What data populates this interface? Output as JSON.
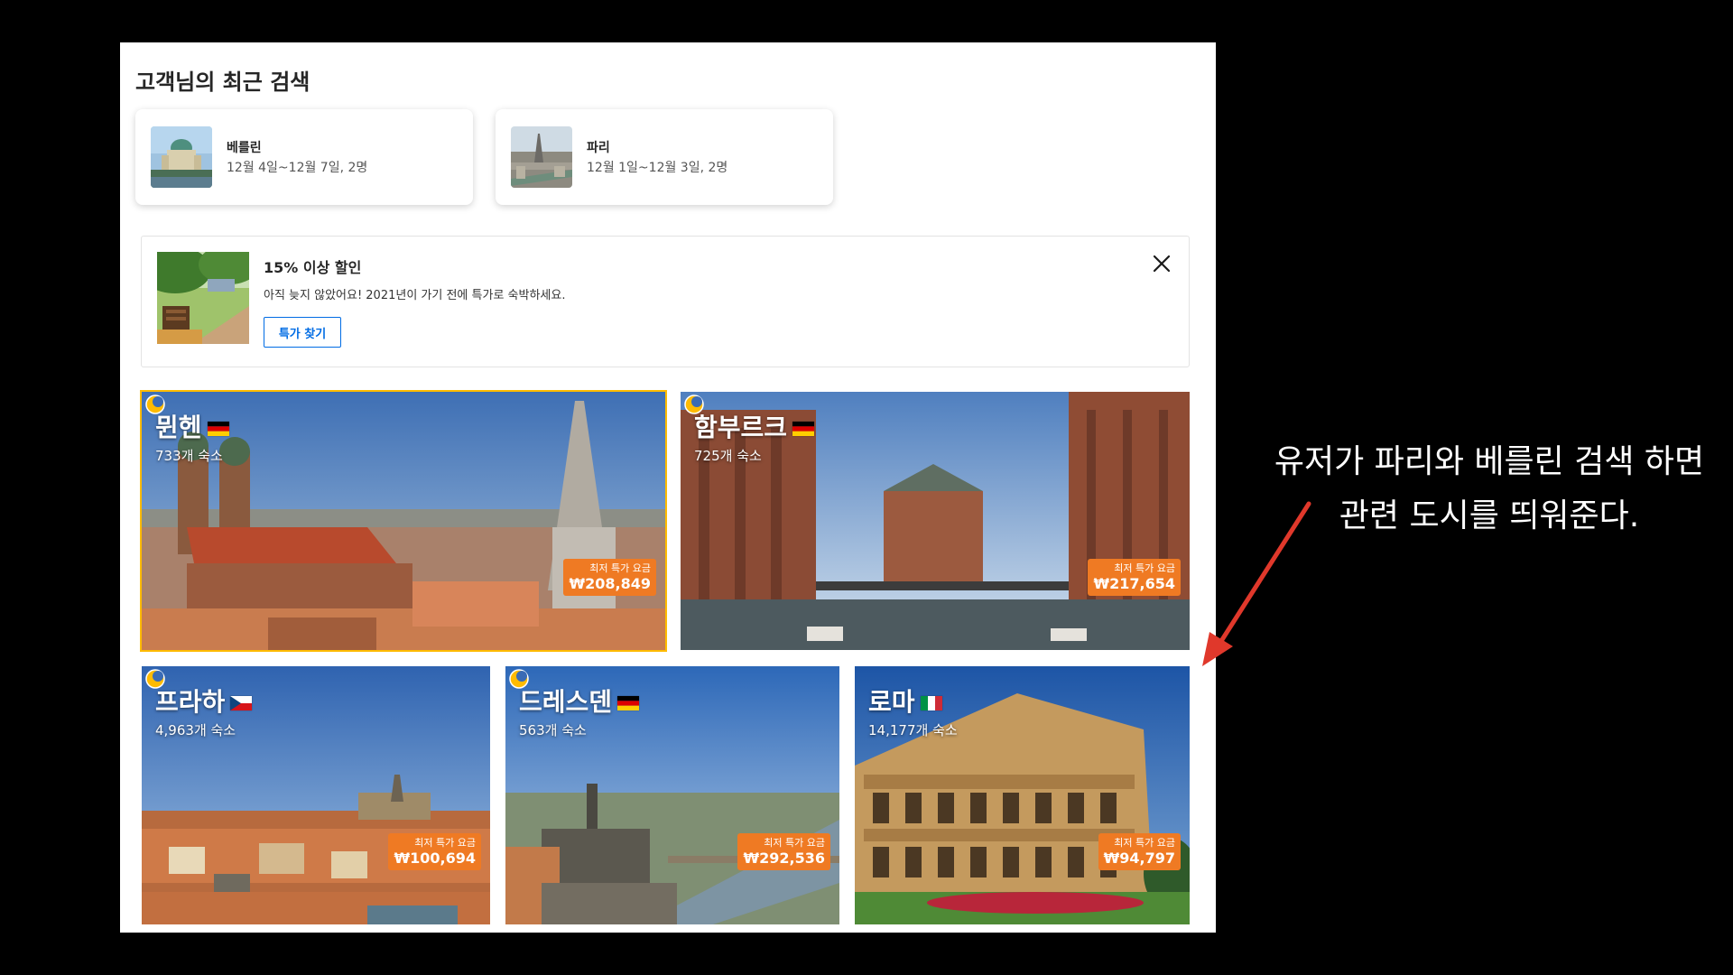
{
  "recent": {
    "title": "고객님의 최근 검색",
    "items": [
      {
        "city": "베를린",
        "dates": "12월 4일~12월 7일, 2명"
      },
      {
        "city": "파리",
        "dates": "12월 1일~12월 3일, 2명"
      }
    ]
  },
  "promo": {
    "title": "15% 이상 할인",
    "description": "아직 늦지 않았어요! 2021년이 가기 전에 특가로 숙박하세요.",
    "button_label": "특가 찾기",
    "close_icon": "close-icon"
  },
  "destinations": [
    {
      "name": "뮌헨",
      "flag": "germany",
      "count": "733개 숙소",
      "price_label": "최저 특가 요금",
      "price": "₩208,849",
      "selected": true
    },
    {
      "name": "함부르크",
      "flag": "germany",
      "count": "725개 숙소",
      "price_label": "최저 특가 요금",
      "price": "₩217,654",
      "selected": false
    },
    {
      "name": "프라하",
      "flag": "czech",
      "count": "4,963개 숙소",
      "price_label": "최저 특가 요금",
      "price": "₩100,694",
      "selected": false
    },
    {
      "name": "드레스덴",
      "flag": "germany",
      "count": "563개 숙소",
      "price_label": "최저 특가 요금",
      "price": "₩292,536",
      "selected": false
    },
    {
      "name": "로마",
      "flag": "italy",
      "count": "14,177개 숙소",
      "price_label": "최저 특가 요금",
      "price": "₩94,797",
      "selected": false
    }
  ],
  "annotation": {
    "line1": "유저가 파리와 베를린 검색 하면",
    "line2": "관련 도시를 띄워준다."
  },
  "colors": {
    "price_badge": "#ef7a23",
    "button_blue": "#006ce4",
    "selected_border": "#febb02",
    "arrow": "#e0382b"
  }
}
